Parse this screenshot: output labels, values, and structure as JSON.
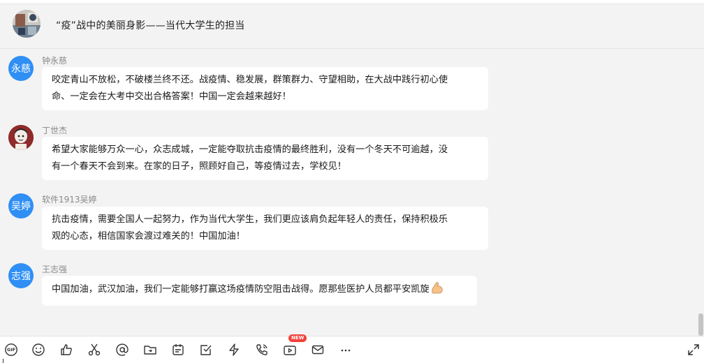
{
  "header": {
    "title": "“疫”战中的美丽身影——当代大学生的担当",
    "avatar_icon": "group-photo-avatar"
  },
  "messages": [
    {
      "sender": "钟永慈",
      "avatar_text": "永慈",
      "avatar_type": "initials",
      "lines": [
        "咬定青山不放松，不破楼兰终不还。战疫情、稳发展，群策群力、守望相助，在大战中践行初心使",
        "命、一定会在大考中交出合格答案！中国一定会越来越好！"
      ]
    },
    {
      "sender": "丁世杰",
      "avatar_text": "",
      "avatar_type": "photo",
      "lines": [
        "希望大家能够万众一心，众志成城，一定能夺取抗击疫情的最终胜利，没有一个冬天不可逾越，没",
        "有一个春天不会到来。在家的日子，照顾好自己，等疫情过去，学校见！"
      ]
    },
    {
      "sender": "软件1913吴婷",
      "avatar_text": "吴婷",
      "avatar_type": "initials",
      "lines": [
        "抗击疫情，需要全国人一起努力，作为当代大学生，我们更应该肩负起年轻人的责任，保持积极乐",
        "观的心态，相信国家会渡过难关的！中国加油！"
      ]
    },
    {
      "sender": "王志强",
      "avatar_text": "志强",
      "avatar_type": "initials",
      "lines": [
        "中国加油，武汉加油，我们一定能够打赢这场疫情防空阻击战得。愿那些医护人员都平安凯旋"
      ],
      "trailing_emoji": "flexed-biceps-emoji"
    }
  ],
  "toolbar": {
    "gif_label": "GIF",
    "new_badge": "NEW",
    "icons": [
      "gif-icon",
      "emoji-icon",
      "thumbs-up-icon",
      "scissors-icon",
      "at-icon",
      "folder-icon",
      "calendar-icon",
      "checkbox-icon",
      "lightning-icon",
      "phone-icon",
      "video-icon",
      "mail-icon",
      "more-icon",
      "expand-icon"
    ]
  },
  "colors": {
    "avatar_blue": "#2f8ff5",
    "background": "#f3f3f3",
    "bubble": "#ffffff",
    "badge_red": "#f2403a"
  }
}
